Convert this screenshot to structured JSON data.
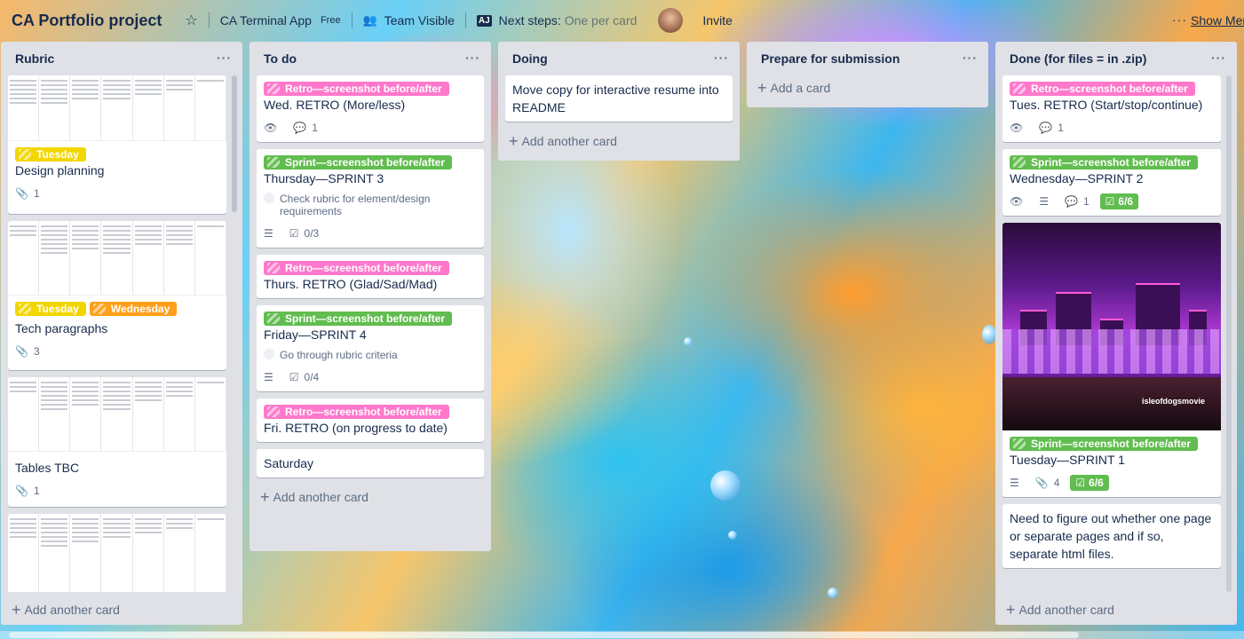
{
  "header": {
    "board_title": "CA Portfolio project",
    "team": "CA Terminal App",
    "plan": "Free",
    "visibility": "Team Visible",
    "next_steps_label": "Next steps:",
    "next_steps_value": "One per card",
    "invite": "Invite",
    "more": "···",
    "show_menu": "Show Menu"
  },
  "lists": {
    "rubric": {
      "title": "Rubric",
      "cards": [
        {
          "labels": [
            "Tuesday"
          ],
          "title": "Design planning",
          "attachments": "1"
        },
        {
          "labels": [
            "Tuesday",
            "Wednesday"
          ],
          "title": "Tech paragraphs",
          "attachments": "3"
        },
        {
          "title": "Tables TBC",
          "attachments": "1"
        }
      ],
      "add": "Add another card"
    },
    "todo": {
      "title": "To do",
      "cards": [
        {
          "label": "Retro—screenshot before/after",
          "title": "Wed. RETRO (More/less)",
          "comments": "1"
        },
        {
          "label": "Sprint—screenshot before/after",
          "title": "Thursday—SPRINT 3",
          "check": "Check rubric for element/design requirements",
          "checklist": "0/3"
        },
        {
          "label": "Retro—screenshot before/after",
          "title": "Thurs. RETRO (Glad/Sad/Mad)"
        },
        {
          "label": "Sprint—screenshot before/after",
          "title": "Friday—SPRINT 4",
          "check": "Go through rubric criteria",
          "checklist": "0/4"
        },
        {
          "label": "Retro—screenshot before/after",
          "title": "Fri. RETRO (on progress to date)"
        },
        {
          "title": "Saturday"
        }
      ],
      "add": "Add another card"
    },
    "doing": {
      "title": "Doing",
      "cards": [
        {
          "title": "Move copy for interactive resume into README"
        }
      ],
      "add": "Add another card"
    },
    "prepare": {
      "title": "Prepare for submission",
      "add": "Add a card"
    },
    "done": {
      "title": "Done (for files = in .zip)",
      "cards": [
        {
          "label": "Retro—screenshot before/after",
          "title": "Tues. RETRO (Start/stop/continue)",
          "comments": "1"
        },
        {
          "label": "Sprint—screenshot before/after",
          "title": "Wednesday—SPRINT 2",
          "comments": "1",
          "checklist": "6/6"
        },
        {
          "label": "Sprint—screenshot before/after",
          "title": "Tuesday—SPRINT 1",
          "attachments": "4",
          "checklist": "6/6",
          "image_watermark": "isleofdogsmovie"
        },
        {
          "title": "Need to figure out whether one page or separate pages and if so, separate html files."
        }
      ],
      "add": "Add another card"
    }
  },
  "colors": {
    "pink_label": "#ff78cb",
    "green_label": "#61bd4f",
    "yellow_label": "#f2d600",
    "orange_label": "#ff9f1a",
    "list_bg": "#dfe1e6"
  }
}
